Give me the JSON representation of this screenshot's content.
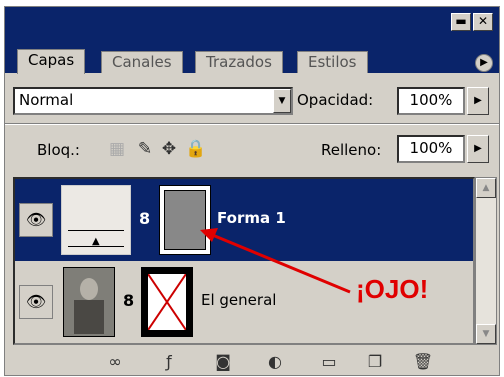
{
  "tabs": [
    {
      "label": "Capas",
      "active": true
    },
    {
      "label": "Canales",
      "active": false
    },
    {
      "label": "Trazados",
      "active": false
    },
    {
      "label": "Estilos",
      "active": false
    }
  ],
  "blend": {
    "mode": "Normal",
    "opacity_label": "Opacidad:",
    "opacity_value": "100%"
  },
  "lock": {
    "label": "Bloq.:",
    "fill_label": "Relleno:",
    "fill_value": "100%"
  },
  "layers": [
    {
      "name": "Forma 1",
      "selected": true
    },
    {
      "name": "El general",
      "selected": false
    }
  ],
  "annotation": {
    "text": "¡OJO!",
    "color": "#e00000"
  },
  "colors": {
    "titlebar": "#0a246a",
    "panel": "#d4d0c8",
    "selection": "#0a246a",
    "annotation": "#e00000"
  }
}
